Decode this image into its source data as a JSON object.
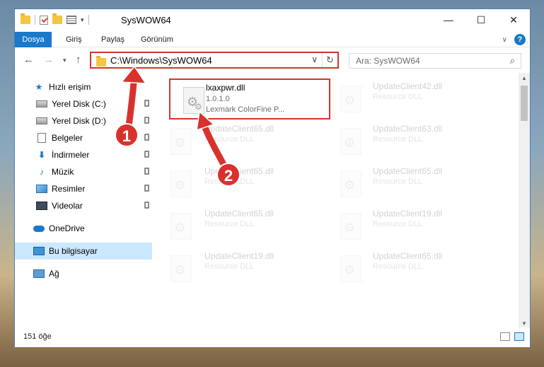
{
  "window": {
    "title": "SysWOW64"
  },
  "ribbon": {
    "tabs": [
      "Dosya",
      "Giriş",
      "Paylaş",
      "Görünüm"
    ]
  },
  "nav": {
    "address": "C:\\Windows\\SysWOW64",
    "search_placeholder": "Ara: SysWOW64"
  },
  "sidebar": {
    "items": [
      {
        "label": "Hızlı erişim",
        "icon": "star-icon"
      },
      {
        "label": "Yerel Disk (C:)",
        "icon": "drive-icon"
      },
      {
        "label": "Yerel Disk (D:)",
        "icon": "drive-icon"
      },
      {
        "label": "Belgeler",
        "icon": "documents-icon"
      },
      {
        "label": "İndirmeler",
        "icon": "downloads-icon"
      },
      {
        "label": "Müzik",
        "icon": "music-icon"
      },
      {
        "label": "Resimler",
        "icon": "pictures-icon"
      },
      {
        "label": "Videolar",
        "icon": "videos-icon"
      },
      {
        "label": "OneDrive",
        "icon": "cloud-icon"
      },
      {
        "label": "Bu bilgisayar",
        "icon": "computer-icon"
      },
      {
        "label": "Ağ",
        "icon": "network-icon"
      }
    ]
  },
  "files": [
    {
      "name": "lxaxpwr.dll",
      "line2": "1.0.1.0",
      "line3": "Lexmark ColorFine P..."
    },
    {
      "name": "UpdateClient42.dll",
      "line2": "Resource DLL"
    },
    {
      "name": "UpdateClient65.dll",
      "line2": "Resource DLL"
    },
    {
      "name": "UpdateClient63.dll",
      "line2": "Resource DLL"
    },
    {
      "name": "UpdateClient65.dll",
      "line2": "Resource DLL"
    },
    {
      "name": "UpdateClient65.dll",
      "line2": "Resource DLL"
    },
    {
      "name": "UpdateClient65.dll",
      "line2": "Resource DLL"
    },
    {
      "name": "UpdateClient19.dll",
      "line2": "Resource DLL"
    },
    {
      "name": "UpdateClient19.dll",
      "line2": "Resource DLL"
    },
    {
      "name": "UpdateClient65.dll",
      "line2": "Resource DLL"
    }
  ],
  "status": {
    "count": "151 öğe"
  },
  "annotations": {
    "marker1": "1",
    "marker2": "2",
    "color": "#d9322e"
  }
}
